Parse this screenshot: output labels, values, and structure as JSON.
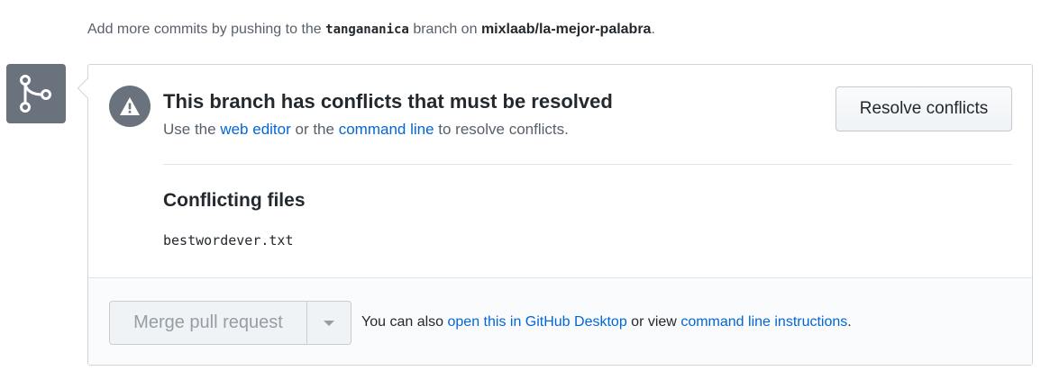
{
  "header": {
    "prefix": "Add more commits by pushing to the",
    "branch": "tangananica",
    "middle": "branch on",
    "repo": "mixlaab/la-mejor-palabra",
    "suffix": "."
  },
  "conflict": {
    "title": "This branch has conflicts that must be resolved",
    "use": "Use the",
    "web_editor": "web editor",
    "or": "or the",
    "command_line": "command line",
    "to_resolve": "to resolve conflicts.",
    "resolve_button": "Resolve conflicts"
  },
  "files": {
    "heading": "Conflicting files",
    "items": [
      "bestwordever.txt"
    ]
  },
  "footer": {
    "merge_button": "Merge pull request",
    "also": "You can also",
    "desktop_link": "open this in GitHub Desktop",
    "or_view": "or view",
    "cli_link": "command line instructions",
    "end": "."
  }
}
